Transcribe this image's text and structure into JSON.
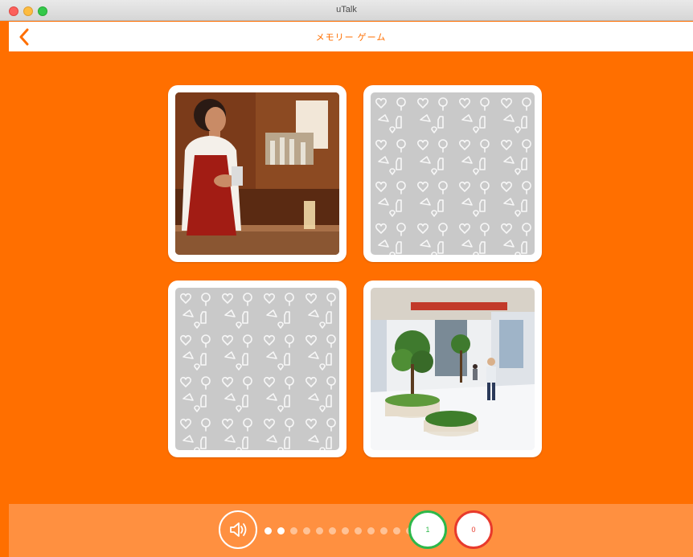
{
  "window": {
    "title": "uTalk"
  },
  "navbar": {
    "title": "メモリー ゲーム",
    "back_icon": "chevron-left-icon"
  },
  "cards": [
    {
      "state": "revealed",
      "subject": "barista-photo"
    },
    {
      "state": "hidden",
      "subject": "card-back-pattern"
    },
    {
      "state": "hidden",
      "subject": "card-back-pattern"
    },
    {
      "state": "revealed",
      "subject": "shopping-mall-photo"
    }
  ],
  "footer": {
    "audio_icon": "speaker-icon",
    "progress": {
      "total": 12,
      "current": 2
    },
    "correct_count": "1",
    "wrong_count": "0"
  },
  "colors": {
    "accent": "#ff6f00",
    "footer": "#ff9040",
    "correct": "#2db84a",
    "wrong": "#e83a2c",
    "card_back": "#c9c9c9"
  }
}
